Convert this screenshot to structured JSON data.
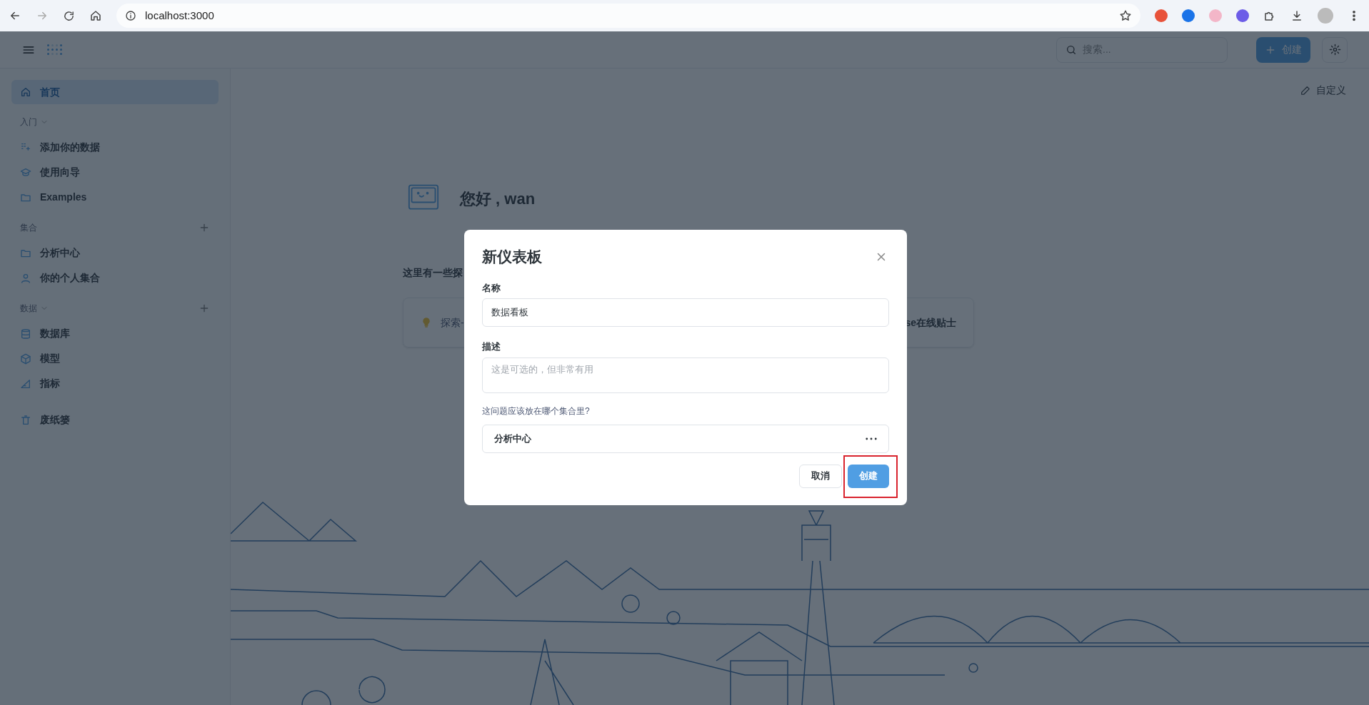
{
  "browser": {
    "url": "localhost:3000"
  },
  "header": {
    "search_placeholder": "搜索...",
    "new_button": "创建"
  },
  "sidebar": {
    "home": {
      "label": "首页",
      "selected": true
    },
    "sections": [
      {
        "title": "入门",
        "expanded": true,
        "items": [
          {
            "label": "添加你的数据"
          },
          {
            "label": "使用向导"
          },
          {
            "label": "Examples"
          }
        ]
      },
      {
        "title": "集合",
        "can_add": true,
        "items": [
          {
            "label": "分析中心"
          },
          {
            "label": "你的个人集合"
          }
        ]
      },
      {
        "title": "数据",
        "expanded": true,
        "can_add": true,
        "items": [
          {
            "label": "数据库"
          },
          {
            "label": "模型"
          },
          {
            "label": "指标"
          }
        ]
      }
    ],
    "trash": "废纸篓"
  },
  "main": {
    "customize": "自定义",
    "greeting": "您好 , wan",
    "explore_heading": "这里有一些探",
    "cards": [
      "探索-",
      "se在线贴士"
    ]
  },
  "dialog": {
    "title": "新仪表板",
    "fields": [
      {
        "kind": "input",
        "label": "名称",
        "value": "数据看板"
      },
      {
        "kind": "textarea",
        "label": "描述",
        "placeholder": "这是可选的，但非常有用"
      },
      {
        "kind": "select",
        "label": "这问题应该放在哪个集合里?",
        "value": "分析中心"
      }
    ],
    "buttons": [
      {
        "kind": "secondary",
        "label": "取消"
      },
      {
        "kind": "primary",
        "label": "创建",
        "highlighted": true
      }
    ]
  }
}
